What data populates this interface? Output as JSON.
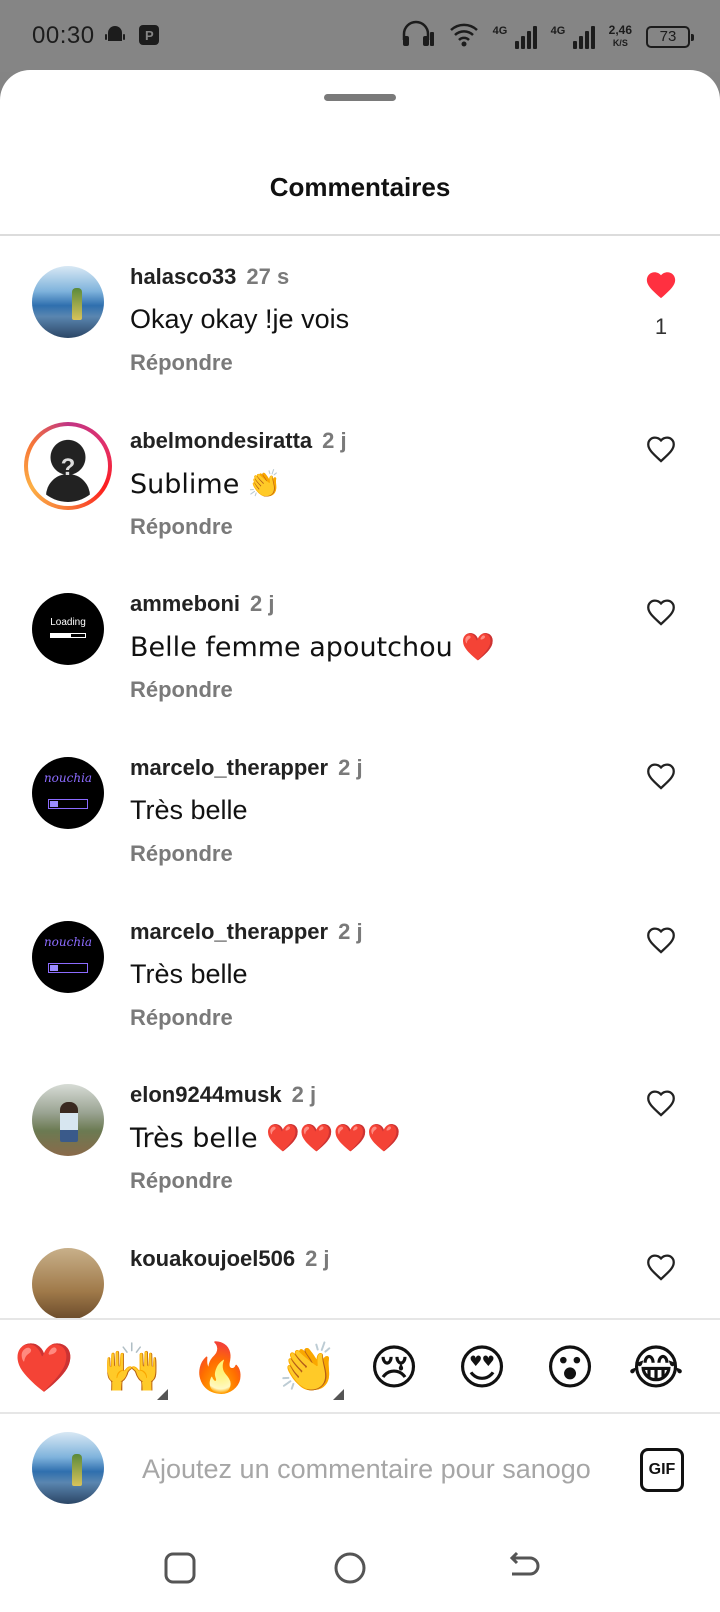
{
  "status_bar": {
    "time": "00:30",
    "net1": "4G",
    "net2": "4G",
    "speed_value": "2,46",
    "speed_unit": "K/S",
    "battery": "73"
  },
  "sheet": {
    "title": "Commentaires"
  },
  "comments": [
    {
      "username": "halasco33",
      "time": "27 s",
      "text": "Okay okay !je vois",
      "reply": "Répondre",
      "liked": true,
      "likes": "1",
      "avatar": "beach-bottle"
    },
    {
      "username": "abelmondesiratta",
      "time": "2 j",
      "text": "Sublime 👏",
      "reply": "Répondre",
      "liked": false,
      "avatar": "question-silhouette"
    },
    {
      "username": "ammeboni",
      "time": "2 j",
      "text": "Belle femme apoutchou ❤️",
      "reply": "Répondre",
      "liked": false,
      "avatar": "loading",
      "avatar_text": "Loading"
    },
    {
      "username": "marcelo_therapper",
      "time": "2 j",
      "text": "Très belle",
      "reply": "Répondre",
      "liked": false,
      "avatar": "nouchia-logo",
      "avatar_text": "nouchia"
    },
    {
      "username": "marcelo_therapper",
      "time": "2 j",
      "text": "Très belle",
      "reply": "Répondre",
      "liked": false,
      "avatar": "nouchia-logo",
      "avatar_text": "nouchia"
    },
    {
      "username": "elon9244musk",
      "time": "2 j",
      "text": "Très belle ❤️❤️❤️❤️",
      "reply": "Répondre",
      "liked": false,
      "avatar": "man-outdoor"
    },
    {
      "username": "kouakoujoel506",
      "time": "2 j",
      "text": "",
      "reply": "",
      "liked": false,
      "avatar": "face"
    }
  ],
  "emoji_bar": [
    "❤️",
    "🙌",
    "🔥",
    "👏",
    "😢",
    "😍",
    "😮",
    "😂"
  ],
  "composer": {
    "placeholder": "Ajoutez un commentaire pour sanogo",
    "gif_label": "GIF"
  },
  "colors": {
    "like_red": "#ff3040",
    "text_secondary": "#7a7a7a"
  },
  "icons": [
    "android-icon",
    "parking-icon",
    "headphones-icon",
    "wifi-icon",
    "signal-icon",
    "battery-icon",
    "heart-icon",
    "square-nav-icon",
    "circle-nav-icon",
    "back-nav-icon"
  ]
}
